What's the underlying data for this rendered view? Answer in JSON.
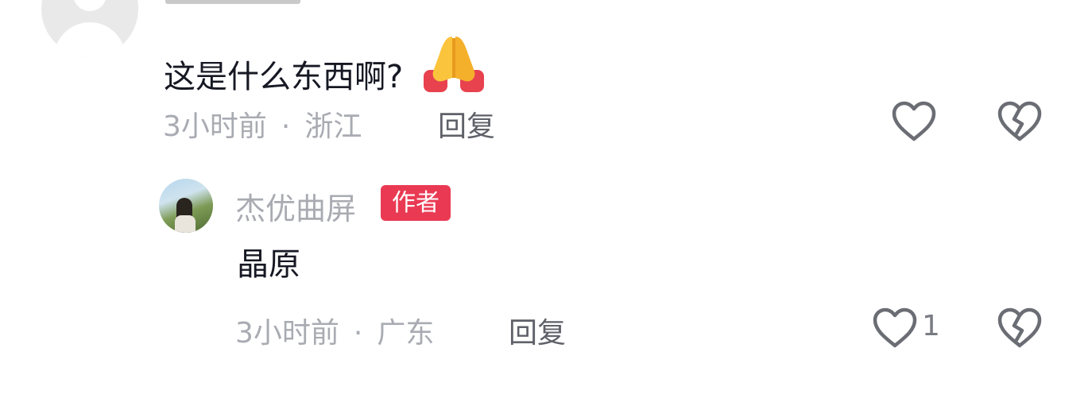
{
  "comments": [
    {
      "text": "这是什么东西啊?",
      "emoji": "folded-hands",
      "time": "3小时前",
      "separator": "·",
      "location": "浙江",
      "reply_label": "回复"
    }
  ],
  "replies": [
    {
      "author": "杰优曲屏",
      "badge": "作者",
      "text": "晶原",
      "time": "3小时前",
      "separator": "·",
      "location": "广东",
      "reply_label": "回复",
      "like_count": "1"
    }
  ],
  "colors": {
    "badge": "#ea3a53",
    "text_primary": "#161823",
    "text_secondary": "#a9abb2"
  }
}
